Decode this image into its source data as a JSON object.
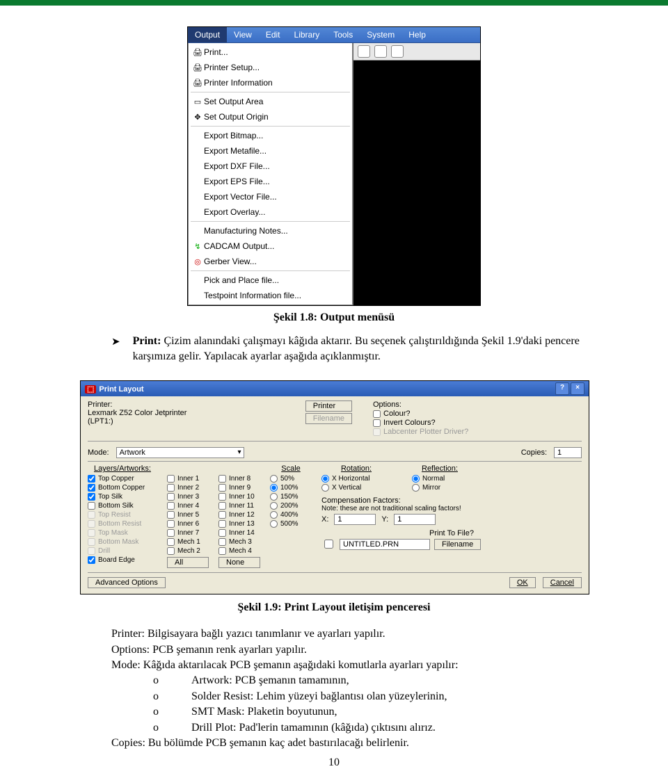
{
  "menubar": [
    "Output",
    "View",
    "Edit",
    "Library",
    "Tools",
    "System",
    "Help"
  ],
  "menu_items": {
    "print": "Print...",
    "printer_setup": "Printer Setup...",
    "printer_info": "Printer Information",
    "set_output_area": "Set Output Area",
    "set_output_origin": "Set Output Origin",
    "export_bitmap": "Export Bitmap...",
    "export_metafile": "Export Metafile...",
    "export_dxf": "Export DXF File...",
    "export_eps": "Export EPS File...",
    "export_vector": "Export Vector File...",
    "export_overlay": "Export Overlay...",
    "mfg_notes": "Manufacturing Notes...",
    "cadcam": "CADCAM Output...",
    "gerber": "Gerber View...",
    "pick_place": "Pick and Place file...",
    "testpoint": "Testpoint Information file..."
  },
  "caption1": "Şekil 1.8: Output menüsü",
  "para1_lead": "Print:",
  "para1_rest": " Çizim alanındaki çalışmayı kâğıda aktarır. Bu seçenek çalıştırıldığında Şekil 1.9'daki pencere karşımıza gelir. Yapılacak ayarlar aşağıda açıklanmıştır.",
  "dialog": {
    "title": "Print Layout",
    "printer_label": "Printer:",
    "printer_name": "Lexmark Z52 Color Jetprinter",
    "printer_port": "(LPT1:)",
    "printer_btn": "Printer",
    "filename_btn": "Filename",
    "options_label": "Options:",
    "opt_colour": "Colour?",
    "opt_invert": "Invert Colours?",
    "opt_labcenter": "Labcenter Plotter Driver?",
    "mode_label": "Mode:",
    "mode_value": "Artwork",
    "copies_label": "Copies:",
    "copies_value": "1",
    "layers_hdr": "Layers/Artworks:",
    "layers_col1": [
      "Top Copper",
      "Bottom Copper",
      "Top Silk",
      "Bottom Silk",
      "Top Resist",
      "Bottom Resist",
      "Top Mask",
      "Bottom Mask",
      "Drill",
      "Board Edge"
    ],
    "layers_col2": [
      "Inner 1",
      "Inner 2",
      "Inner 3",
      "Inner 4",
      "Inner 5",
      "Inner 6",
      "Inner 7",
      "Mech 1",
      "Mech 2"
    ],
    "layers_col3": [
      "Inner 8",
      "Inner 9",
      "Inner 10",
      "Inner 11",
      "Inner 12",
      "Inner 13",
      "Inner 14",
      "Mech 3",
      "Mech 4"
    ],
    "all_btn": "All",
    "none_btn": "None",
    "scale_hdr": "Scale",
    "scale_opts": [
      "50%",
      "100%",
      "150%",
      "200%",
      "400%",
      "500%"
    ],
    "rotation_hdr": "Rotation:",
    "rot_h": "X Horizontal",
    "rot_v": "X Vertical",
    "reflection_hdr": "Reflection:",
    "ref_normal": "Normal",
    "ref_mirror": "Mirror",
    "comp_hdr": "Compensation Factors:",
    "comp_note": "Note: these are not traditional scaling factors!",
    "comp_x": "X:",
    "comp_xv": "1",
    "comp_y": "Y:",
    "comp_yv": "1",
    "print_to_file": "Print To File?",
    "filename_field": "UNTITLED.PRN",
    "filename_lbl": "Filename",
    "adv_opts": "Advanced Options",
    "ok": "OK",
    "cancel": "Cancel"
  },
  "caption2": "Şekil 1.9: Print Layout iletişim penceresi",
  "defs": {
    "printer": "Printer: Bilgisayara bağlı yazıcı tanımlanır ve ayarları yapılır.",
    "options": "Options: PCB şemanın renk ayarları yapılır.",
    "mode": "Mode: Kâğıda aktarılacak PCB şemanın aşağıdaki komutlarla ayarları yapılır:",
    "artwork": "Artwork: PCB şemanın tamamının,",
    "solder": "Solder Resist: Lehim yüzeyi bağlantısı olan yüzeylerinin,",
    "smt": "SMT Mask: Plaketin boyutunun,",
    "drill": "Drill Plot: Pad'lerin tamamının (kâğıda) çıktısını alırız.",
    "copies": "Copies: Bu bölümde PCB şemanın kaç adet bastırılacağı belirlenir."
  },
  "page_num": "10"
}
